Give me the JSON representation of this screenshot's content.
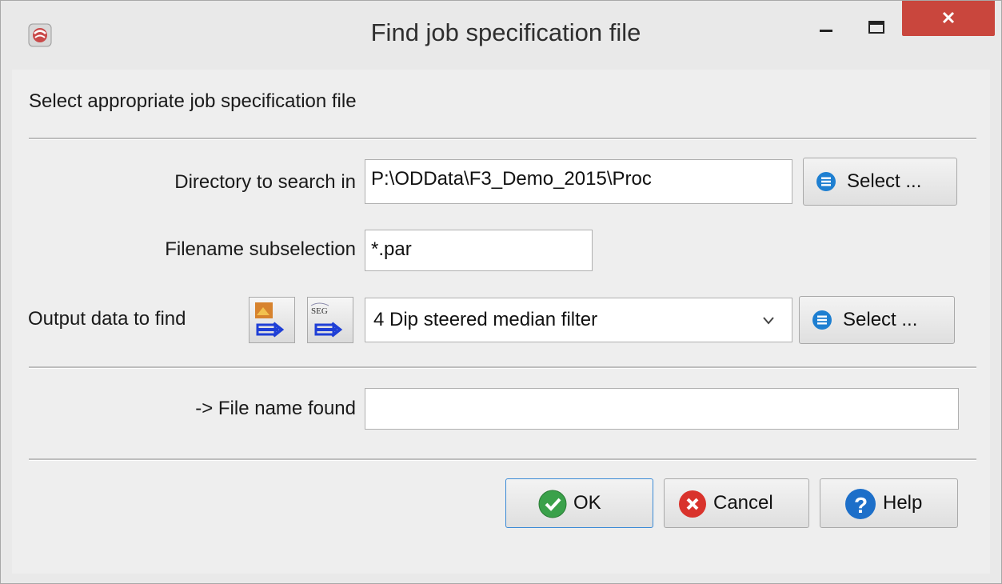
{
  "window": {
    "title": "Find job specification file",
    "icons": {
      "app": "app-logo-icon",
      "minimize": "minimize-icon",
      "maximize": "maximize-icon",
      "close": "close-icon"
    }
  },
  "dialog": {
    "header": "Select appropriate job specification file",
    "directory": {
      "label": "Directory to search in",
      "value": "P:\\ODData\\F3_Demo_2015\\Proc",
      "select_label": "Select ..."
    },
    "filename": {
      "label": "Filename subselection",
      "value": "*.par"
    },
    "output": {
      "label": "Output data to find",
      "icon_1": "output-image-icon",
      "icon_2": "seg-output-icon",
      "selected": "4 Dip steered median filter",
      "select_label": "Select ..."
    },
    "found": {
      "label": "-> File name found",
      "value": ""
    },
    "buttons": {
      "ok": "OK",
      "cancel": "Cancel",
      "help": "Help"
    },
    "colors": {
      "select_icon": "#1e7fd1",
      "ok_icon": "#3aa14a",
      "cancel_icon": "#d9332c",
      "help_icon": "#1d6fc9",
      "close_button": "#c9463d"
    }
  }
}
